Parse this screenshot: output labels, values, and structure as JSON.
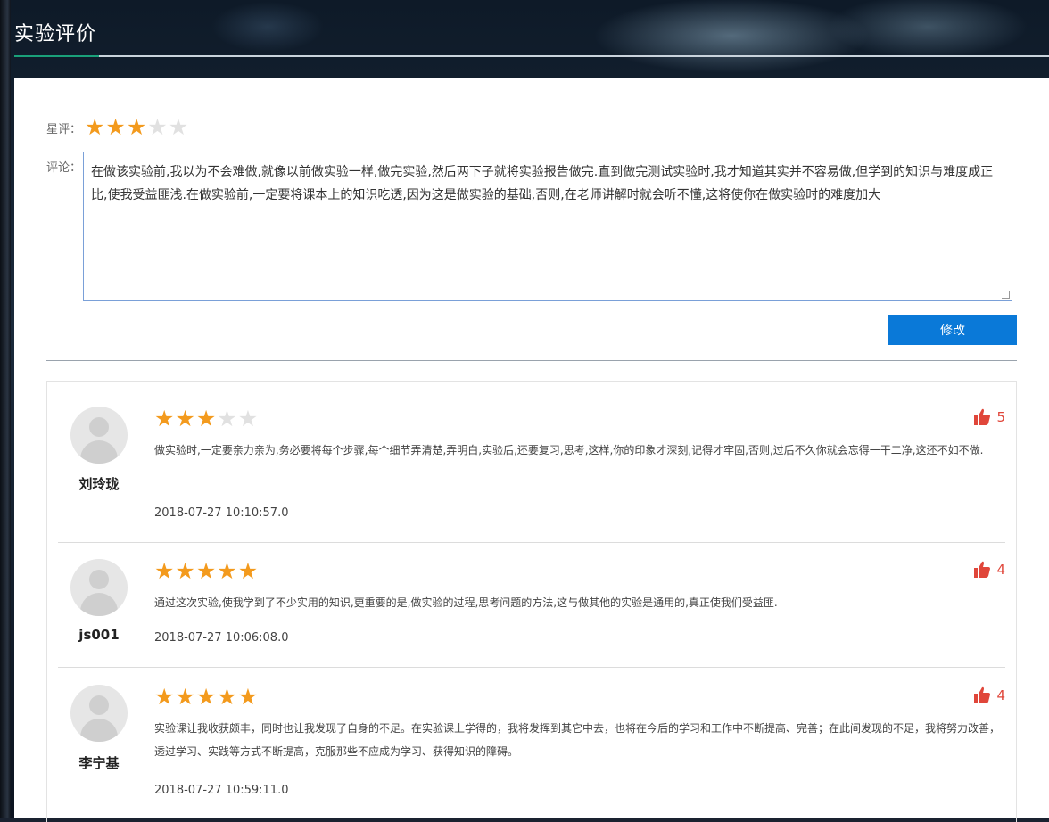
{
  "page": {
    "title": "实验评价"
  },
  "rating": {
    "label": "星评：",
    "stars": 3,
    "max": 5
  },
  "comment": {
    "label": "评论：",
    "value": "在做该实验前,我以为不会难做,就像以前做实验一样,做完实验,然后两下子就将实验报告做完.直到做完测试实验时,我才知道其实并不容易做,但学到的知识与难度成正比,使我受益匪浅.在做实验前,一定要将课本上的知识吃透,因为这是做实验的基础,否则,在老师讲解时就会听不懂,这将使你在做实验时的难度加大"
  },
  "modify_button": {
    "label": "修改"
  },
  "reviews": [
    {
      "username": "刘玲珑",
      "stars": 3,
      "text": "做实验时,一定要亲力亲为,务必要将每个步骤,每个细节弄清楚,弄明白,实验后,还要复习,思考,这样,你的印象才深刻,记得才牢固,否则,过后不久你就会忘得一干二净,这还不如不做.",
      "time": "2018-07-27 10:10:57.0",
      "likes": "5"
    },
    {
      "username": "js001",
      "stars": 5,
      "text": "通过这次实验,使我学到了不少实用的知识,更重要的是,做实验的过程,思考问题的方法,这与做其他的实验是通用的,真正使我们受益匪.",
      "time": "2018-07-27 10:06:08.0",
      "likes": "4"
    },
    {
      "username": "李宁基",
      "stars": 5,
      "text": "实验课让我收获颇丰，同时也让我发现了自身的不足。在实验课上学得的，我将发挥到其它中去，也将在今后的学习和工作中不断提高、完善；在此间发现的不足，我将努力改善，透过学习、实践等方式不断提高，克服那些不应成为学习、获得知识的障碍。",
      "time": "2018-07-27 10:59:11.0",
      "likes": "4"
    }
  ],
  "colors": {
    "star_on": "#f39a1d",
    "star_off": "#e1e1e1",
    "button": "#0a79d8",
    "like": "#e0463a",
    "accent": "#1aa17a"
  },
  "icons": {
    "star": "star-icon",
    "like": "thumbs-up-icon",
    "avatar": "user-avatar-icon"
  }
}
